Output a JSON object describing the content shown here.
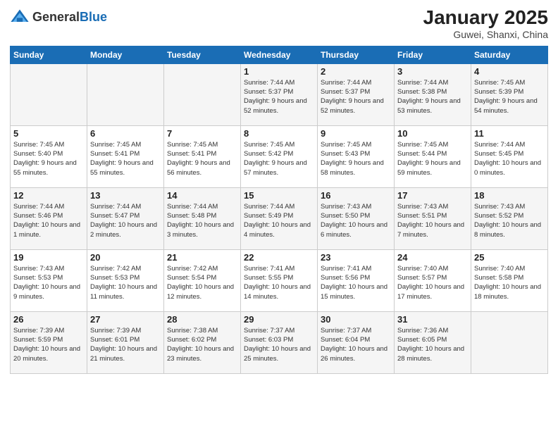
{
  "logo": {
    "general": "General",
    "blue": "Blue"
  },
  "header": {
    "month": "January 2025",
    "location": "Guwei, Shanxi, China"
  },
  "weekdays": [
    "Sunday",
    "Monday",
    "Tuesday",
    "Wednesday",
    "Thursday",
    "Friday",
    "Saturday"
  ],
  "weeks": [
    [
      {
        "day": "",
        "info": ""
      },
      {
        "day": "",
        "info": ""
      },
      {
        "day": "",
        "info": ""
      },
      {
        "day": "1",
        "info": "Sunrise: 7:44 AM\nSunset: 5:37 PM\nDaylight: 9 hours and 52 minutes."
      },
      {
        "day": "2",
        "info": "Sunrise: 7:44 AM\nSunset: 5:37 PM\nDaylight: 9 hours and 52 minutes."
      },
      {
        "day": "3",
        "info": "Sunrise: 7:44 AM\nSunset: 5:38 PM\nDaylight: 9 hours and 53 minutes."
      },
      {
        "day": "4",
        "info": "Sunrise: 7:45 AM\nSunset: 5:39 PM\nDaylight: 9 hours and 54 minutes."
      }
    ],
    [
      {
        "day": "5",
        "info": "Sunrise: 7:45 AM\nSunset: 5:40 PM\nDaylight: 9 hours and 55 minutes."
      },
      {
        "day": "6",
        "info": "Sunrise: 7:45 AM\nSunset: 5:41 PM\nDaylight: 9 hours and 55 minutes."
      },
      {
        "day": "7",
        "info": "Sunrise: 7:45 AM\nSunset: 5:41 PM\nDaylight: 9 hours and 56 minutes."
      },
      {
        "day": "8",
        "info": "Sunrise: 7:45 AM\nSunset: 5:42 PM\nDaylight: 9 hours and 57 minutes."
      },
      {
        "day": "9",
        "info": "Sunrise: 7:45 AM\nSunset: 5:43 PM\nDaylight: 9 hours and 58 minutes."
      },
      {
        "day": "10",
        "info": "Sunrise: 7:45 AM\nSunset: 5:44 PM\nDaylight: 9 hours and 59 minutes."
      },
      {
        "day": "11",
        "info": "Sunrise: 7:44 AM\nSunset: 5:45 PM\nDaylight: 10 hours and 0 minutes."
      }
    ],
    [
      {
        "day": "12",
        "info": "Sunrise: 7:44 AM\nSunset: 5:46 PM\nDaylight: 10 hours and 1 minute."
      },
      {
        "day": "13",
        "info": "Sunrise: 7:44 AM\nSunset: 5:47 PM\nDaylight: 10 hours and 2 minutes."
      },
      {
        "day": "14",
        "info": "Sunrise: 7:44 AM\nSunset: 5:48 PM\nDaylight: 10 hours and 3 minutes."
      },
      {
        "day": "15",
        "info": "Sunrise: 7:44 AM\nSunset: 5:49 PM\nDaylight: 10 hours and 4 minutes."
      },
      {
        "day": "16",
        "info": "Sunrise: 7:43 AM\nSunset: 5:50 PM\nDaylight: 10 hours and 6 minutes."
      },
      {
        "day": "17",
        "info": "Sunrise: 7:43 AM\nSunset: 5:51 PM\nDaylight: 10 hours and 7 minutes."
      },
      {
        "day": "18",
        "info": "Sunrise: 7:43 AM\nSunset: 5:52 PM\nDaylight: 10 hours and 8 minutes."
      }
    ],
    [
      {
        "day": "19",
        "info": "Sunrise: 7:43 AM\nSunset: 5:53 PM\nDaylight: 10 hours and 9 minutes."
      },
      {
        "day": "20",
        "info": "Sunrise: 7:42 AM\nSunset: 5:53 PM\nDaylight: 10 hours and 11 minutes."
      },
      {
        "day": "21",
        "info": "Sunrise: 7:42 AM\nSunset: 5:54 PM\nDaylight: 10 hours and 12 minutes."
      },
      {
        "day": "22",
        "info": "Sunrise: 7:41 AM\nSunset: 5:55 PM\nDaylight: 10 hours and 14 minutes."
      },
      {
        "day": "23",
        "info": "Sunrise: 7:41 AM\nSunset: 5:56 PM\nDaylight: 10 hours and 15 minutes."
      },
      {
        "day": "24",
        "info": "Sunrise: 7:40 AM\nSunset: 5:57 PM\nDaylight: 10 hours and 17 minutes."
      },
      {
        "day": "25",
        "info": "Sunrise: 7:40 AM\nSunset: 5:58 PM\nDaylight: 10 hours and 18 minutes."
      }
    ],
    [
      {
        "day": "26",
        "info": "Sunrise: 7:39 AM\nSunset: 5:59 PM\nDaylight: 10 hours and 20 minutes."
      },
      {
        "day": "27",
        "info": "Sunrise: 7:39 AM\nSunset: 6:01 PM\nDaylight: 10 hours and 21 minutes."
      },
      {
        "day": "28",
        "info": "Sunrise: 7:38 AM\nSunset: 6:02 PM\nDaylight: 10 hours and 23 minutes."
      },
      {
        "day": "29",
        "info": "Sunrise: 7:37 AM\nSunset: 6:03 PM\nDaylight: 10 hours and 25 minutes."
      },
      {
        "day": "30",
        "info": "Sunrise: 7:37 AM\nSunset: 6:04 PM\nDaylight: 10 hours and 26 minutes."
      },
      {
        "day": "31",
        "info": "Sunrise: 7:36 AM\nSunset: 6:05 PM\nDaylight: 10 hours and 28 minutes."
      },
      {
        "day": "",
        "info": ""
      }
    ]
  ]
}
